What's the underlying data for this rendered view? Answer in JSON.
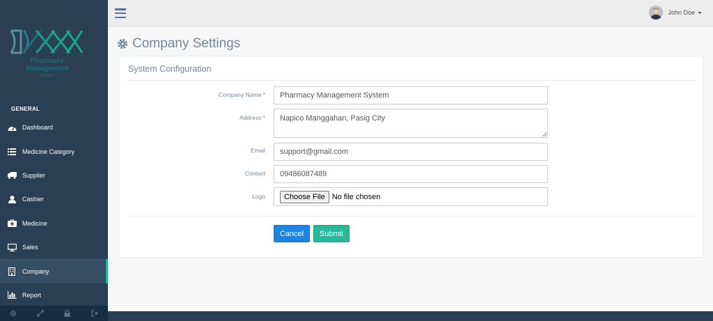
{
  "app": {
    "logo_text": "Pharmacy Management",
    "logo_sub": "System"
  },
  "sidebar": {
    "section_title": "GENERAL",
    "items": [
      {
        "label": "Dashboard",
        "icon": "dashboard-icon"
      },
      {
        "label": "Medicine Category",
        "icon": "list-icon"
      },
      {
        "label": "Supplier",
        "icon": "truck-icon"
      },
      {
        "label": "Cashier",
        "icon": "user-icon"
      },
      {
        "label": "Medicine",
        "icon": "medkit-icon"
      },
      {
        "label": "Sales",
        "icon": "desktop-icon"
      },
      {
        "label": "Company",
        "icon": "building-icon",
        "active": true
      },
      {
        "label": "Report",
        "icon": "bar-chart-icon"
      }
    ],
    "footer_icons": [
      "gear-icon",
      "fullscreen-icon",
      "lock-icon",
      "logout-icon"
    ]
  },
  "topbar": {
    "menu_icon": "hamburger-icon",
    "user_name": "John Doe"
  },
  "page": {
    "title": "Company Settings",
    "title_icon": "gear-icon"
  },
  "panel": {
    "title": "System Configuration",
    "fields": {
      "company_name": {
        "label": "Company Name *",
        "value": "Pharmacy Management System"
      },
      "address": {
        "label": "Address *",
        "value": "Napico Manggahan, Pasig City"
      },
      "email": {
        "label": "Email",
        "value": "support@gmail.com"
      },
      "contact": {
        "label": "Contact",
        "value": "09486087489"
      },
      "logo": {
        "label": "Logo",
        "button": "Choose File",
        "status": "No file chosen"
      }
    },
    "cancel_label": "Cancel",
    "submit_label": "Submit"
  },
  "colors": {
    "sidebar_bg": "#2a3f54",
    "accent": "#1abb9c",
    "cancel": "#1b84e7",
    "submit": "#26b99a"
  }
}
